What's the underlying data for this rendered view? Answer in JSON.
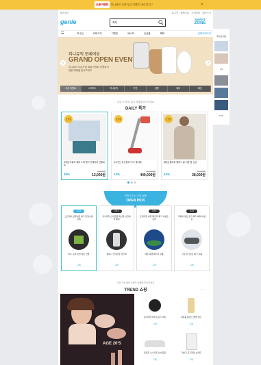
{
  "topbar": {
    "banner_text": "지니뮤직 오픈기념 이벤트 바로가기 〉",
    "badge": "오픈이벤트",
    "close": "×"
  },
  "toplinks": {
    "left": "즐겨찾기",
    "right": [
      "로그인",
      "회원가입",
      "고객센터",
      "장바구니"
    ]
  },
  "header": {
    "logo": "genie",
    "search_value": "지니",
    "zone_line1": "SMART",
    "zone_line2": "ZONE"
  },
  "nav": {
    "menu_icon": "menu-icon",
    "items": [
      "지니딜",
      "카테고리",
      "기획전",
      "베스트",
      "신상품",
      "혜택"
    ],
    "extra": "전체카테고리"
  },
  "hero": {
    "line1": "지니뮤직 토베여성",
    "line2": "GRAND OPEN EVENT",
    "line3": "지니뮤직 오픈기념 특별 이벤트 진행중 다양한 혜택을 만나보세요",
    "tabs": [
      "오픈 이벤트",
      "스타벅스",
      "지니뮤직",
      "가전",
      "생활",
      "뷰티",
      "패션"
    ]
  },
  "daily": {
    "sub": "오늘 단 하루! 특가 상품을 만나보세요",
    "title": "DAILY 특가",
    "deals": [
      {
        "badge": "오늘만",
        "name": "[리빙] 디퓨저 세트 스틱 향기 인테리어 선물세트",
        "pct": "30%",
        "orig": "19,000원",
        "price": "13,000원"
      },
      {
        "badge": "오늘만",
        "name": "[다이슨] 무선청소기 V7 플러피",
        "pct": "12%",
        "orig": "499,000원",
        "price": "449,000원"
      },
      {
        "badge": "오늘만",
        "name": "[패션] 플라워 원피스 롱 쉬폰 봄 신상",
        "pct": "44%",
        "orig": "69,000원",
        "price": "38,000원"
      }
    ]
  },
  "open_section": {
    "sub": "이번주 지니 오픈 상품",
    "title": "OPEN PICK"
  },
  "pcards": [
    {
      "tag": "오픈1",
      "desc": "스킨케어 선물세트 특가 한정수량 판매",
      "name": "비누 수제 천연 세트 선물",
      "cnt": "구매"
    },
    {
      "tag": "오픈2",
      "desc": "지니뮤직 스마트폰 최신형 사전예약 혜택",
      "name": "갤럭시 스마트폰 자급제",
      "cnt": "구매"
    },
    {
      "tag": "오픈3",
      "desc": "프리미엄 여행 패키지 특가 이벤트 진행",
      "name": "제주 여행 패키지 상품",
      "cnt": "구매"
    },
    {
      "tag": "오픈4",
      "desc": "자동차 렌트 장기 특가 혜택 이벤트",
      "name": "신차 장기렌트 특가 상품",
      "cnt": "구매"
    }
  ],
  "trend": {
    "sub": "지금 가장 핫한 트렌드 상품을 만나보세요",
    "title": "TREND 쇼핑",
    "nav": "‹ ›",
    "big_text": "AGE 20'S",
    "cards": [
      {
        "text": "프리미엄 블랙 도자기 세트",
        "price": "구매"
      },
      {
        "text": "화장품 에센스 앰플 세트",
        "price": "구매"
      },
      {
        "text": "운동화 스니커즈 남녀공용",
        "price": "구매"
      },
      {
        "text": "가습기 공기청정 스마트",
        "price": "구매"
      }
    ]
  },
  "right_col": {
    "labels": [
      "최근본상품",
      "1/3",
      "TOP"
    ]
  },
  "colors": {
    "accent": "#2aa5d8",
    "topbar": "#f5c43a",
    "hero_bg": "#f3e1c4",
    "teal": "#3ec1c9"
  }
}
